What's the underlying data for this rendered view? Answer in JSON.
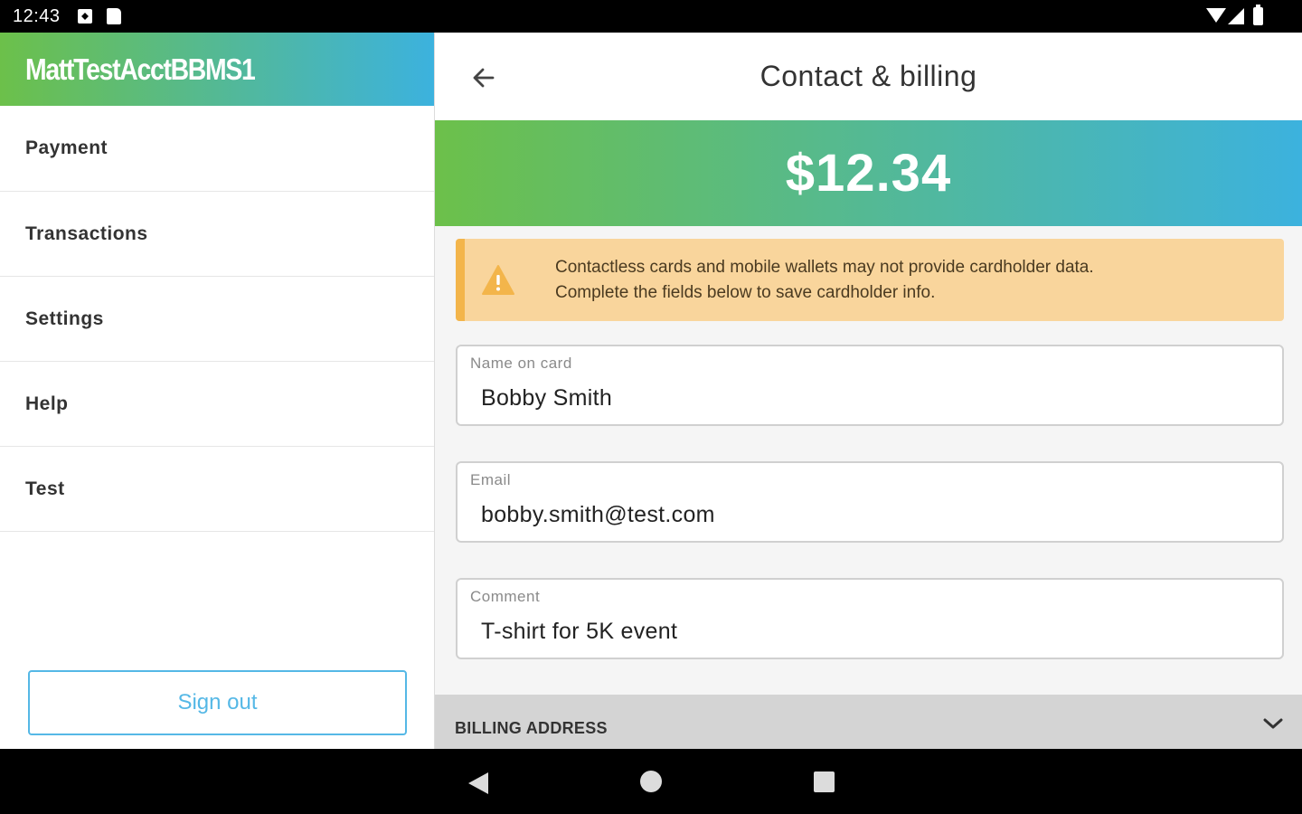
{
  "status_bar": {
    "time": "12:43",
    "icons": [
      "notification-icon",
      "sd-card-icon",
      "wifi-icon",
      "signal-icon",
      "battery-icon"
    ]
  },
  "drawer": {
    "account_name": "MattTestAcctBBMS1",
    "items": [
      {
        "label": "Payment"
      },
      {
        "label": "Transactions"
      },
      {
        "label": "Settings"
      },
      {
        "label": "Help"
      },
      {
        "label": "Test"
      }
    ],
    "sign_out_label": "Sign out"
  },
  "header": {
    "back_icon": "arrow-left-icon",
    "title": "Contact & billing"
  },
  "amount": "$12.34",
  "warning": {
    "icon": "warning-triangle-icon",
    "line1": "Contactless cards and mobile wallets may not provide cardholder data.",
    "line2": "Complete the fields below to save cardholder info."
  },
  "form": {
    "name": {
      "label": "Name on card",
      "value": "Bobby Smith"
    },
    "email": {
      "label": "Email",
      "value": "bobby.smith@test.com"
    },
    "comment": {
      "label": "Comment",
      "value": "T-shirt for 5K event"
    }
  },
  "billing_section": {
    "label": "BILLING ADDRESS",
    "icon": "chevron-down-icon"
  },
  "nav_bar": {
    "icons": [
      "nav-back-icon",
      "nav-home-icon",
      "nav-recents-icon"
    ]
  },
  "colors": {
    "gradient_start": "#6cc04a",
    "gradient_end": "#3cb2de",
    "warning_bg": "#f9d59c",
    "warning_accent": "#f3b54b",
    "sign_out_blue": "#55b8e6"
  }
}
